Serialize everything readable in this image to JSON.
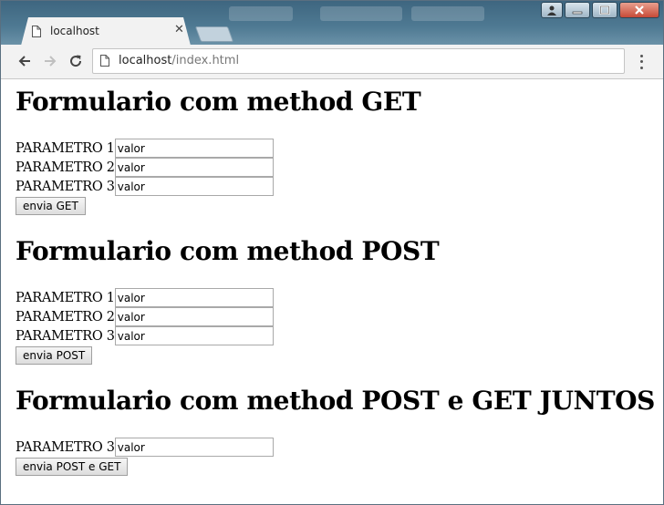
{
  "browser": {
    "tab_title": "localhost",
    "url_host": "localhost",
    "url_path": "/index.html"
  },
  "forms": [
    {
      "heading": "Formulario com method GET",
      "fields": [
        {
          "label": "PARAMETRO 1",
          "value": "valor"
        },
        {
          "label": "PARAMETRO 2",
          "value": "valor"
        },
        {
          "label": "PARAMETRO 3",
          "value": "valor"
        }
      ],
      "button": "envia GET"
    },
    {
      "heading": "Formulario com method POST",
      "fields": [
        {
          "label": "PARAMETRO 1",
          "value": "valor"
        },
        {
          "label": "PARAMETRO 2",
          "value": "valor"
        },
        {
          "label": "PARAMETRO 3",
          "value": "valor"
        }
      ],
      "button": "envia POST"
    },
    {
      "heading": "Formulario com method POST e GET JUNTOS",
      "fields": [
        {
          "label": "PARAMETRO 3",
          "value": "valor"
        }
      ],
      "button": "envia POST e GET"
    }
  ]
}
